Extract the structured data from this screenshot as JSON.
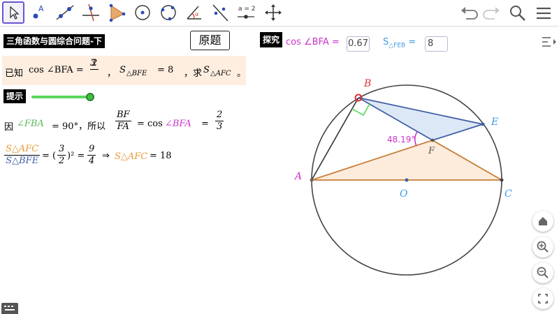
{
  "toolbar": {
    "tools": [
      {
        "name": "move-tool",
        "icon": "arrow-cursor-icon"
      },
      {
        "name": "point-tool",
        "icon": "point-icon",
        "letter": "A"
      },
      {
        "name": "line-tool",
        "icon": "line-icon"
      },
      {
        "name": "perpendicular-tool",
        "icon": "perpendicular-icon"
      },
      {
        "name": "polygon-tool",
        "icon": "polygon-icon"
      },
      {
        "name": "circle-tool",
        "icon": "circle-center-icon"
      },
      {
        "name": "circle-3pt-tool",
        "icon": "circle-three-points-icon"
      },
      {
        "name": "angle-tool",
        "icon": "angle-icon"
      },
      {
        "name": "reflect-tool",
        "icon": "reflect-icon"
      },
      {
        "name": "slider-tool",
        "icon": "slider-icon",
        "label": "a = 2"
      },
      {
        "name": "move-view-tool",
        "icon": "move-graphics-icon"
      }
    ],
    "selected_tool": "move-tool"
  },
  "left_panel": {
    "title": "三角函数与圆综合问题-下",
    "original_button": "原题",
    "given": {
      "prefix": "已知",
      "cos_expr": "cos ∠BFA =",
      "cos_num": "2",
      "cos_den": "3",
      "comma1": "，",
      "area_expr": "S",
      "area_sub": "△BFE",
      "area_eq": "= 8",
      "ask": "，求",
      "ask_area": "S",
      "ask_sub": "△AFC",
      "period": "。"
    },
    "hint_label": "提示",
    "slider_value": 1.0,
    "step1": {
      "prefix": "因",
      "angle": "∠FBA",
      "eq": "= 90°，所以",
      "frac_num": "BF",
      "frac_den": "FA",
      "eq2": "= cos",
      "angle2": "∠BFA",
      "eq3": "=",
      "res_num": "2",
      "res_den": "3"
    },
    "step2": {
      "ratio_num": "S△AFC",
      "ratio_den": "S△BFE",
      "eq": "= (",
      "base_num": "3",
      "base_den": "2",
      "power": ")² =",
      "res_num": "9",
      "res_den": "4",
      "arrow": "⇒",
      "target": "S△AFC",
      "final": "=  18"
    }
  },
  "right_panel": {
    "explore_label": "探究",
    "cos_label": "cos ∠BFA =",
    "cos_value": "0.67",
    "area_label": "S",
    "area_sub": "△FEB",
    "area_eq": "=",
    "area_value": "8",
    "points": {
      "A": "A",
      "B": "B",
      "C": "C",
      "E": "E",
      "F": "F",
      "O": "O"
    },
    "angle_label": "48.19°"
  },
  "colors": {
    "accent": "#6557d2",
    "magenta": "#cc33cc",
    "blue": "#3f5fa5",
    "light_blue": "#3f9be5",
    "orange": "#c87f3a",
    "green": "#5cd65c",
    "red": "#e23030"
  },
  "side_buttons": [
    "home-icon",
    "zoom-in-icon",
    "zoom-out-icon",
    "fullscreen-icon"
  ]
}
